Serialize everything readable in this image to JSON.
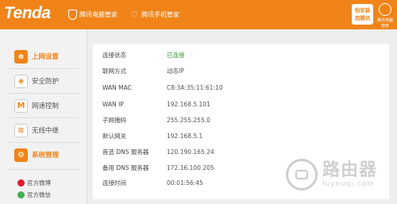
{
  "header": {
    "logo": "Tenda",
    "link1": "腾讯电脑管家",
    "link2": "腾讯手机管家",
    "badge_line1": "怕安装",
    "badge_line2": "用腾讯",
    "badge2_caption": "腾讯电脑管家"
  },
  "sidebar": {
    "items": [
      {
        "label": "上网设置",
        "icon": "e"
      },
      {
        "label": "安全防护",
        "icon": "shield"
      },
      {
        "label": "网速控制",
        "icon": "m"
      },
      {
        "label": "无线中继",
        "icon": "wifi"
      },
      {
        "label": "系统管理",
        "icon": "gear"
      }
    ],
    "social": [
      {
        "label": "官方微博"
      },
      {
        "label": "官方微信"
      }
    ]
  },
  "status": [
    {
      "label": "连接状态",
      "value": "已连接"
    },
    {
      "label": "联网方式",
      "value": "动态IP"
    },
    {
      "label": "WAN MAC",
      "value": "C8:3A:35:11:61:10"
    },
    {
      "label": "WAN IP",
      "value": "192.168.5.101"
    },
    {
      "label": "子网掩码",
      "value": "255.255.255.0"
    },
    {
      "label": "默认网关",
      "value": "192.168.5.1"
    },
    {
      "label": "首选 DNS 服务器",
      "value": "120.190.165.24"
    },
    {
      "label": "备用 DNS 服务器",
      "value": "172.16.100.205"
    },
    {
      "label": "连接时间",
      "value": "00:01:56:45"
    }
  ],
  "watermark": {
    "cn": "路由器",
    "en": "luyouqi.com"
  },
  "colors": {
    "accent": "#f08418",
    "connected": "#2a9c2a"
  }
}
